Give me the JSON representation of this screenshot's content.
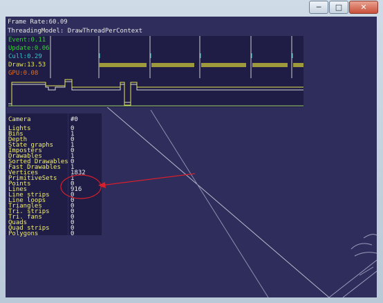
{
  "window": {
    "buttons": [
      {
        "name": "minimize-button",
        "glyph": "─"
      },
      {
        "name": "maximize-button",
        "glyph": "□"
      },
      {
        "name": "close-button",
        "glyph": "✕"
      }
    ]
  },
  "hud": {
    "frame_rate": "Frame Rate:60.09",
    "threading_model": "ThreadingModel: DrawThreadPerContext"
  },
  "timings": [
    {
      "label": "Event:0.11",
      "color": "#35d235"
    },
    {
      "label": "Update:0.06",
      "color": "#35d235"
    },
    {
      "label": "Cull:0.29",
      "color": "#35c7cf"
    },
    {
      "label": "Draw:13.53",
      "color": "#e6e84f"
    },
    {
      "label": "GPU:0.08",
      "color": "#e26f1f"
    }
  ],
  "stats": {
    "camera_label": "Camera",
    "camera_value": "#0",
    "rows": [
      {
        "label": "Lights",
        "value": "0"
      },
      {
        "label": "Bins",
        "value": "1"
      },
      {
        "label": "Depth",
        "value": "0"
      },
      {
        "label": "State graphs",
        "value": "1"
      },
      {
        "label": "Imposters",
        "value": "0"
      },
      {
        "label": "Drawables",
        "value": "1"
      },
      {
        "label": "Sorted Drawables",
        "value": "0"
      },
      {
        "label": "Fast Drawables",
        "value": "1"
      },
      {
        "label": "Vertices",
        "value": "1832"
      },
      {
        "label": "PrimitiveSets",
        "value": "1"
      },
      {
        "label": "Points",
        "value": "0"
      },
      {
        "label": "Lines",
        "value": "916"
      },
      {
        "label": "Line strips",
        "value": "0"
      },
      {
        "label": "Line loops",
        "value": "0"
      },
      {
        "label": "Triangles",
        "value": "0"
      },
      {
        "label": "Tri. strips",
        "value": "0"
      },
      {
        "label": "Tri. fans",
        "value": "0"
      },
      {
        "label": "Quads",
        "value": "0"
      },
      {
        "label": "Quad strips",
        "value": "0"
      },
      {
        "label": "Polygons",
        "value": "0"
      }
    ]
  },
  "colors": {
    "background": "#2f2d5b",
    "panel": "#1f1d45",
    "stat_label": "#f3f06f",
    "annotation": "#d81f2a"
  }
}
